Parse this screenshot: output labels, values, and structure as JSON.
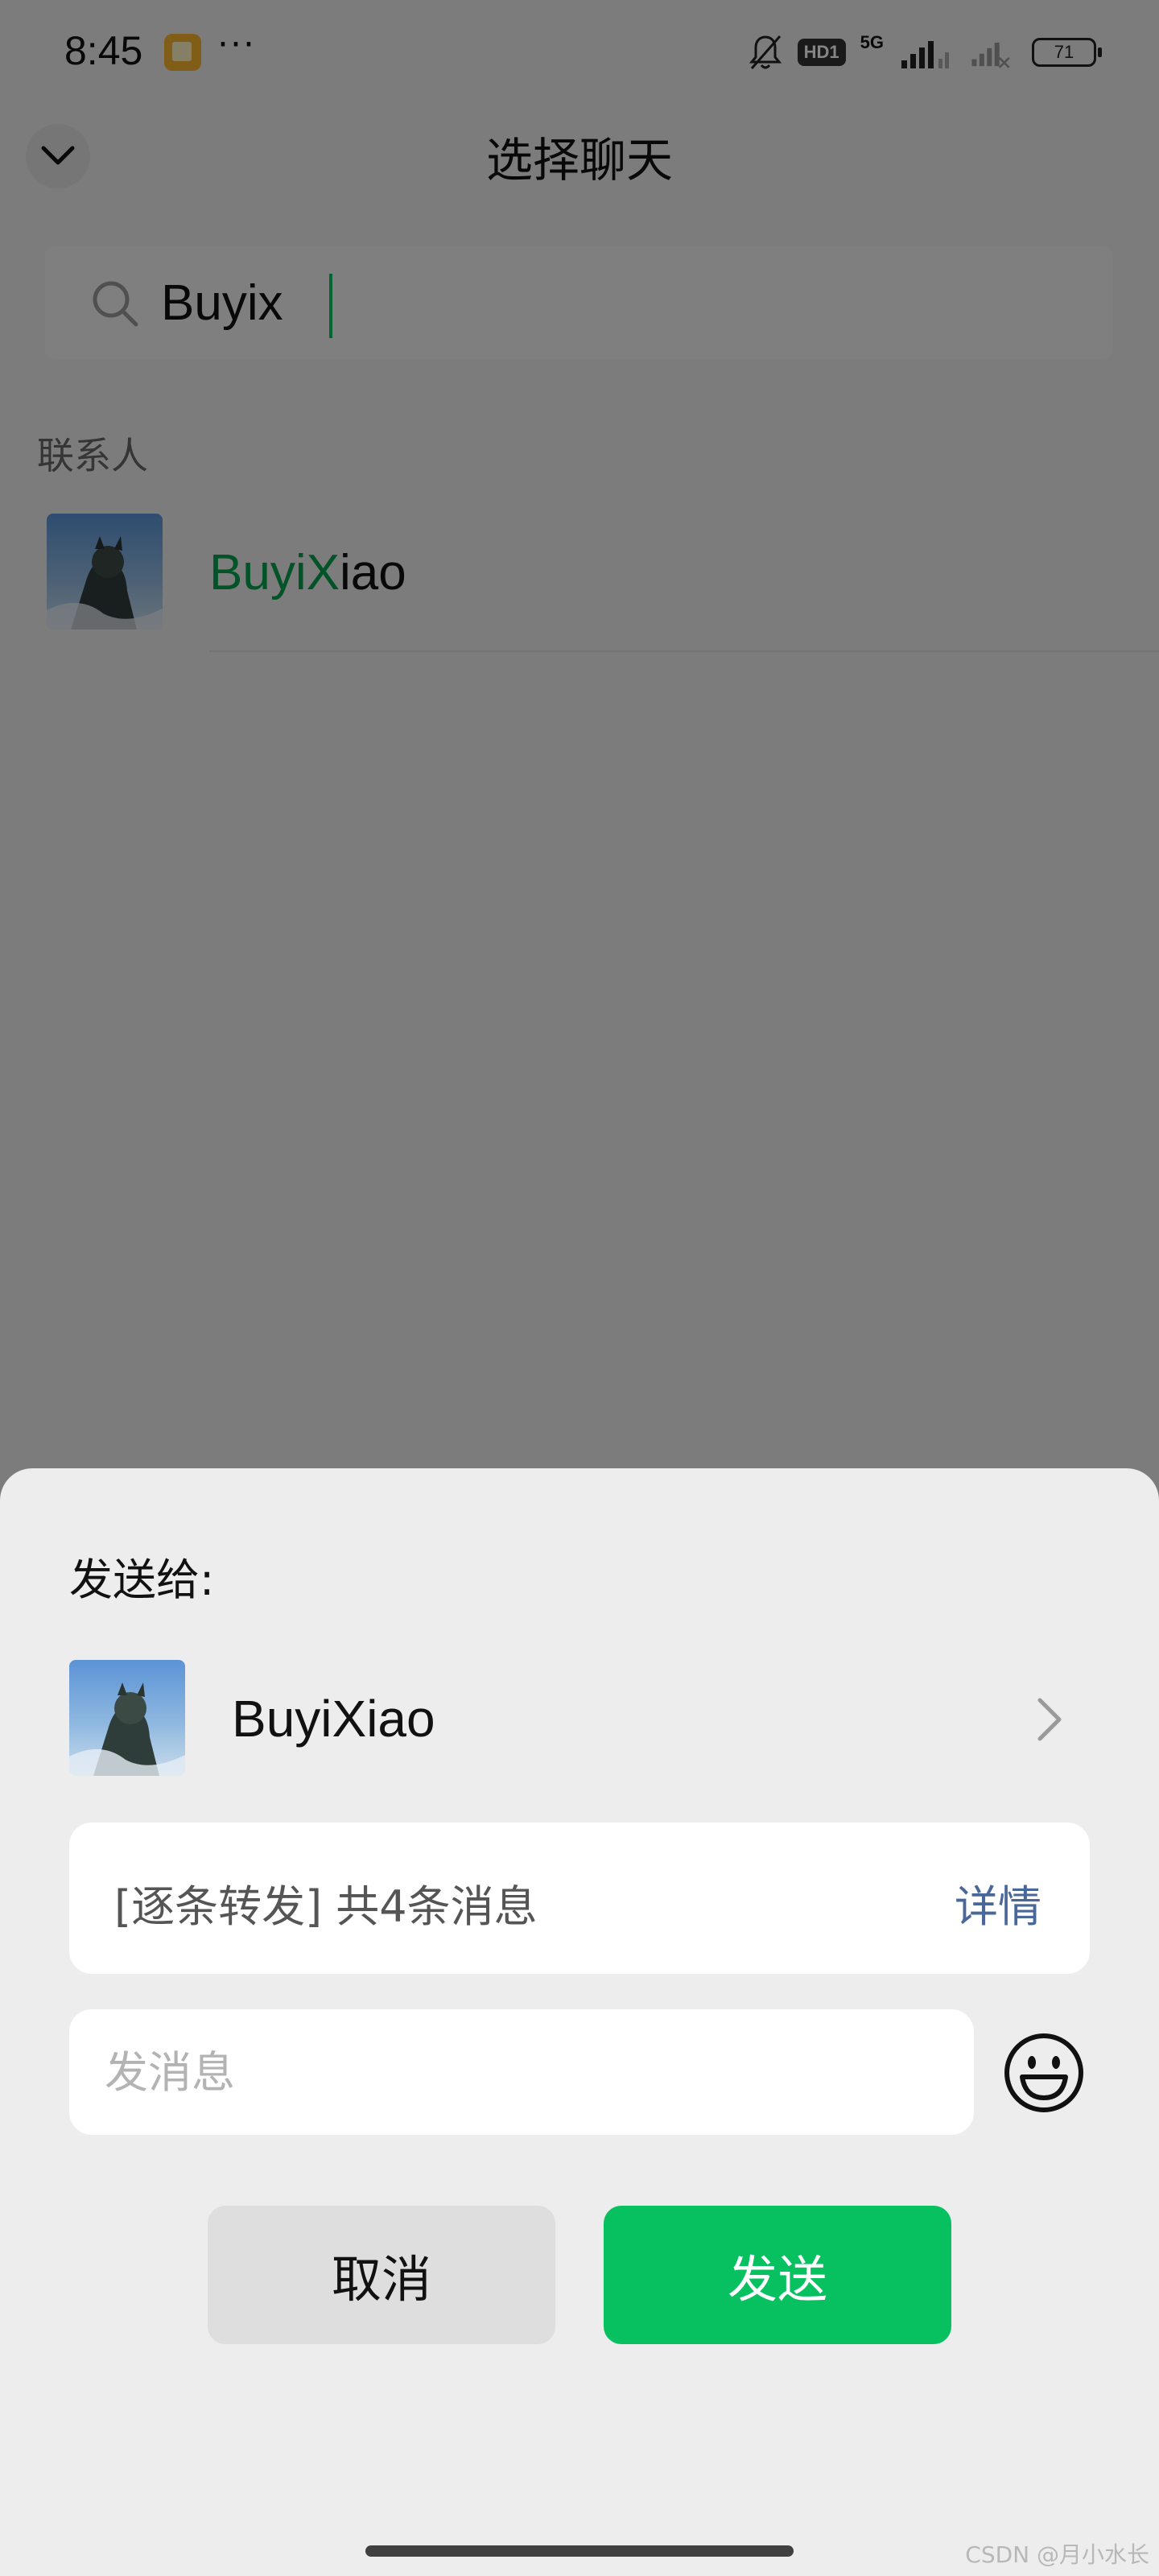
{
  "status_bar": {
    "time": "8:45",
    "more_indicator": "···",
    "hd_badge": "HD1",
    "network_type": "5G",
    "battery_level": "71",
    "icons": [
      "app-notification-icon",
      "bell-off-icon",
      "signal-icon",
      "battery-icon"
    ]
  },
  "header": {
    "title": "选择聊天",
    "collapse_icon": "chevron-down-icon"
  },
  "search": {
    "value": "Buyix",
    "icon": "search-icon"
  },
  "contacts": {
    "section_label": "联系人",
    "items": [
      {
        "name_highlight": "BuyiX",
        "name_rest": "iao",
        "avatar": "avatar-image"
      }
    ]
  },
  "send_sheet": {
    "title": "发送给:",
    "recipient": {
      "name": "BuyiXiao",
      "avatar": "avatar-image"
    },
    "forward_summary": "[逐条转发] 共4条消息",
    "details_label": "详情",
    "message_placeholder": "发消息",
    "emoji_icon": "emoji-icon",
    "cancel_label": "取消",
    "send_label": "发送"
  },
  "colors": {
    "accent": "#07c160",
    "highlight_text": "#07a050",
    "link": "#4a6799",
    "sheet_background": "#ededed",
    "overlay": "rgba(0,0,0,0.48)"
  },
  "watermark": "CSDN @月小水长"
}
